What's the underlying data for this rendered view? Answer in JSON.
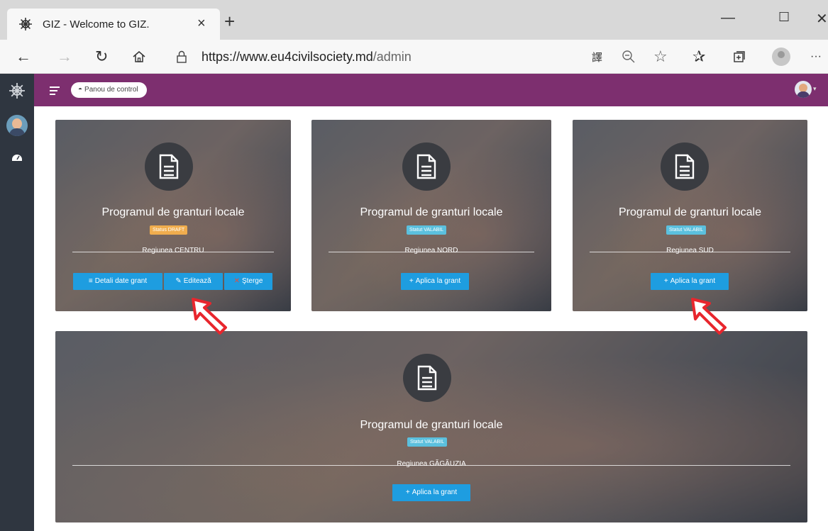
{
  "browser": {
    "tab_title": "GIZ - Welcome to GIZ.",
    "tab_close": "×",
    "new_tab": "+",
    "url_host": "https://www.eu4civilsociety.md",
    "url_path": "/admin",
    "win_minimize": "—",
    "win_maximize": "☐",
    "win_close": "✕",
    "more": "···"
  },
  "app": {
    "breadcrumb": "Panou de control"
  },
  "cards": [
    {
      "title": "Programul de granturi locale",
      "status": "Status DRAFT",
      "region": "Regiunea CENTRU",
      "buttons": {
        "details": "Detali date grant",
        "edit": "Editează",
        "delete": "Şterge"
      }
    },
    {
      "title": "Programul de granturi locale",
      "status": "Statut VALABIL",
      "region": "Regiunea NORD",
      "buttons": {
        "apply": "Aplica la grant"
      }
    },
    {
      "title": "Programul de granturi locale",
      "status": "Statut VALABIL",
      "region": "Regiunea SUD",
      "buttons": {
        "apply": "Aplica la grant"
      }
    },
    {
      "title": "Programul de granturi locale",
      "status": "Statut VALABIL",
      "region": "Regiunea GĂGĂUZIA",
      "buttons": {
        "apply": "Aplica la grant"
      }
    }
  ],
  "colors": {
    "appbar": "#7d2f6f",
    "sidebar": "#2f3640",
    "button": "#1e9de0",
    "draft_badge": "#f0ad4e",
    "valid_badge": "#5bc0de",
    "annotation_arrow": "#e8262d"
  }
}
